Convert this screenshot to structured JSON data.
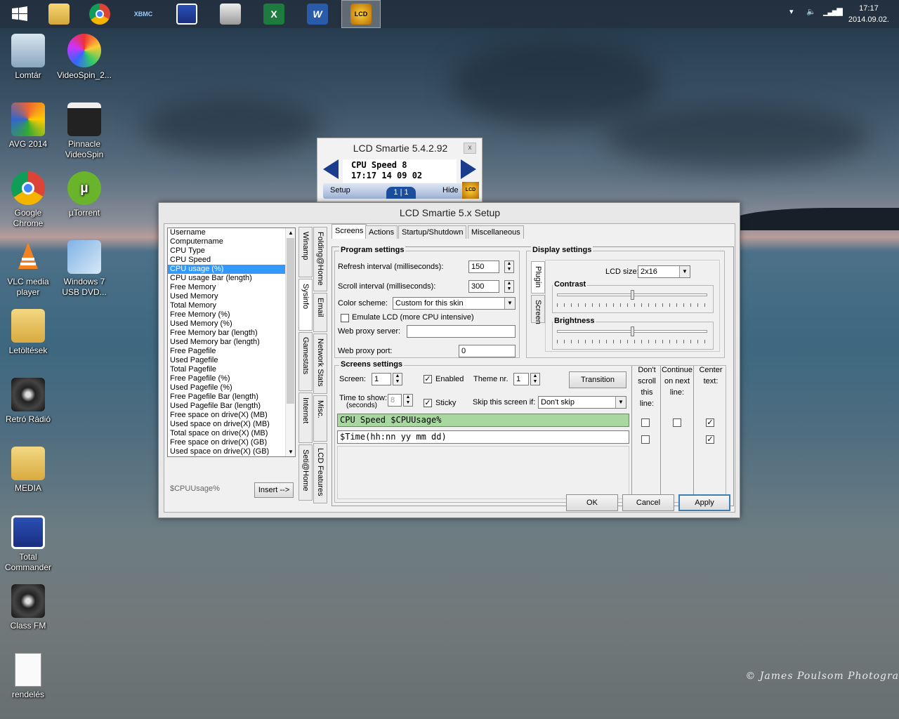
{
  "taskbar": {
    "apps": [
      {
        "name": "start-icon"
      },
      {
        "name": "explorer-icon"
      },
      {
        "name": "chrome-icon"
      },
      {
        "name": "xbmc-icon",
        "label": "XBMC"
      },
      {
        "name": "total-commander-icon"
      },
      {
        "name": "printer-fax-icon"
      },
      {
        "name": "excel-icon",
        "label": "X"
      },
      {
        "name": "word-icon",
        "label": "W"
      },
      {
        "name": "lcd-smartie-icon",
        "label": "LCD"
      }
    ],
    "clock": {
      "time": "17:17",
      "date": "2014.09.02."
    }
  },
  "desktop": {
    "icons": [
      {
        "label": "Lomtár"
      },
      {
        "label": "VideoSpin_2..."
      },
      {
        "label": "AVG 2014"
      },
      {
        "label": "Pinnacle VideoSpin"
      },
      {
        "label": "Google Chrome"
      },
      {
        "label": "µTorrent"
      },
      {
        "label": "VLC media player"
      },
      {
        "label": "Windows 7 USB DVD..."
      },
      {
        "label": "Letöltések"
      },
      {
        "label": "Retró Rádió"
      },
      {
        "label": "MEDIA"
      },
      {
        "label": "Total Commander"
      },
      {
        "label": "Class FM"
      },
      {
        "label": "rendelés"
      }
    ],
    "watermark": "© James Poulsom Photogra"
  },
  "mini": {
    "title": "LCD Smartie 5.4.2.92",
    "close": "x",
    "line1": "CPU Speed 8",
    "line2": "17:17 14 09 02",
    "setup": "Setup",
    "pager": "1 | 1",
    "hide": "Hide",
    "logo": "LCD"
  },
  "setup": {
    "title": "LCD Smartie 5.x Setup",
    "list": [
      "Username",
      "Computername",
      "CPU Type",
      "CPU Speed",
      "CPU usage (%)",
      "CPU usage Bar (length)",
      "Free Memory",
      "Used Memory",
      "Total Memory",
      "Free Memory (%)",
      "Used Memory (%)",
      "Free Memory bar (length)",
      "Used Memory bar (length)",
      "Free Pagefile",
      "Used Pagefile",
      "Total Pagefile",
      "Free Pagefile (%)",
      "Used Pagefile (%)",
      "Free Pagefile Bar (length)",
      "Used Pagefile Bar (length)",
      "Free space on drive(X) (MB)",
      "Used space on drive(X) (MB)",
      "Total space on drive(X) (MB)",
      "Free space on drive(X) (GB)",
      "Used space on drive(X) (GB)"
    ],
    "selected_index": 4,
    "preview": "$CPUUsage%",
    "insert": "Insert -->",
    "vtabs_left": [
      "Winamp",
      "Sysinfo",
      "Gamestats",
      "Internet",
      "Seti@Home"
    ],
    "vtabs_right": [
      "Folding@Home",
      "Email",
      "Network Stats",
      "Misc.",
      "LCD Features"
    ],
    "tabs": [
      "Screens",
      "Actions",
      "Startup/Shutdown",
      "Miscellaneous"
    ],
    "program": {
      "title": "Program settings",
      "refresh_label": "Refresh interval (milliseconds):",
      "refresh": "150",
      "scroll_label": "Scroll interval (milliseconds):",
      "scroll": "300",
      "scheme_label": "Color scheme:",
      "scheme": "Custom for this skin",
      "emulate": "Emulate LCD  (more CPU intensive)",
      "proxy_label": "Web proxy server:",
      "proxy": "",
      "port_label": "Web proxy port:",
      "port": "0"
    },
    "display": {
      "title": "Display settings",
      "side_tabs": [
        "Plugin",
        "Screen"
      ],
      "lcd_label": "LCD size:",
      "lcd_size": "2x16",
      "contrast": "Contrast",
      "contrast_level": 0.5,
      "brightness": "Brightness",
      "brightness_level": 0.5
    },
    "screens": {
      "title": "Screens settings",
      "screen_label": "Screen:",
      "screen": "1",
      "enabled": "Enabled",
      "theme_label": "Theme nr.",
      "theme": "1",
      "transition": "Transition",
      "time_label": "Time to show:",
      "time_sub": "(seconds)",
      "time": "8",
      "sticky": "Sticky",
      "skip_label": "Skip this screen if:",
      "skip": "Don't skip",
      "col1": "Don't scroll this line:",
      "col2": "Continue on next line:",
      "col3": "Center text:",
      "line1": "CPU Speed $CPUUsage%",
      "line2": "$Time(hh:nn yy mm dd)",
      "checkmark": "✓",
      "line1_bg": "#a8d8a0"
    },
    "buttons": {
      "ok": "OK",
      "cancel": "Cancel",
      "apply": "Apply"
    }
  }
}
